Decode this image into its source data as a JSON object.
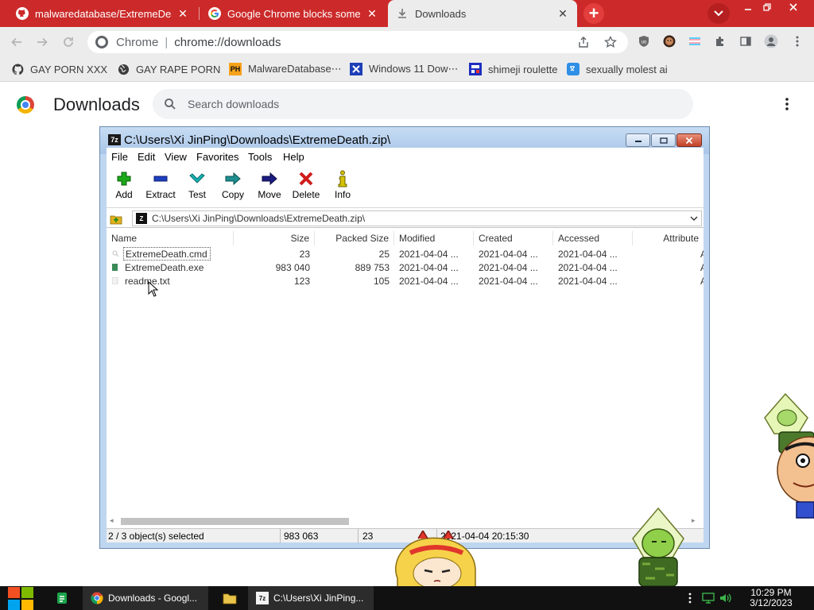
{
  "tabs": [
    {
      "title": "malwaredatabase/ExtremeDea",
      "icon": "github-icon"
    },
    {
      "title": "Google Chrome blocks some d",
      "icon": "google-icon"
    },
    {
      "title": "Downloads",
      "icon": "download-icon"
    }
  ],
  "toolbar": {
    "omnibox_host": "Chrome",
    "omnibox_url": "chrome://downloads"
  },
  "bookmarks": [
    {
      "label": "GAY PORN XXX",
      "icon": "github-icon"
    },
    {
      "label": "GAY RAPE PORN",
      "icon": "globe-icon"
    },
    {
      "label": "MalwareDatabase⋯",
      "icon": "ph-icon",
      "icon_text": "PH"
    },
    {
      "label": "Windows 11 Dow⋯",
      "icon": "x-icon"
    },
    {
      "label": "shimeji roulette",
      "icon": "mft-icon"
    },
    {
      "label": "sexually molest ai",
      "icon": "translate-icon"
    }
  ],
  "downloads": {
    "title": "Downloads",
    "search_placeholder": "Search downloads"
  },
  "zip": {
    "title": "C:\\Users\\Xi JinPing\\Downloads\\ExtremeDeath.zip\\",
    "menu": [
      "File",
      "Edit",
      "View",
      "Favorites",
      "Tools",
      "Help"
    ],
    "tools": [
      {
        "label": "Add",
        "icon": "plus-icon",
        "color": "#1aa81a"
      },
      {
        "label": "Extract",
        "icon": "minus-icon",
        "color": "#1f3fbf"
      },
      {
        "label": "Test",
        "icon": "check-icon",
        "color": "#19b3b3"
      },
      {
        "label": "Copy",
        "icon": "copy-arrow-icon",
        "color": "#1d8f8f"
      },
      {
        "label": "Move",
        "icon": "move-arrow-icon",
        "color": "#1b1b80"
      },
      {
        "label": "Delete",
        "icon": "delete-x-icon",
        "color": "#d01c1c"
      },
      {
        "label": "Info",
        "icon": "info-icon",
        "color": "#d6c200"
      }
    ],
    "path": "C:\\Users\\Xi JinPing\\Downloads\\ExtremeDeath.zip\\",
    "columns": [
      "Name",
      "Size",
      "Packed Size",
      "Modified",
      "Created",
      "Accessed",
      "Attribute"
    ],
    "files": [
      {
        "name": "ExtremeDeath.cmd",
        "size": "23",
        "packed": "25",
        "modified": "2021-04-04 ...",
        "created": "2021-04-04 ...",
        "accessed": "2021-04-04 ...",
        "attr": "A",
        "icon_color": "#bfbfbf"
      },
      {
        "name": "ExtremeDeath.exe",
        "size": "983 040",
        "packed": "889 753",
        "modified": "2021-04-04 ...",
        "created": "2021-04-04 ...",
        "accessed": "2021-04-04 ...",
        "attr": "A",
        "icon_color": "#3a8a5a"
      },
      {
        "name": "readme.txt",
        "size": "123",
        "packed": "105",
        "modified": "2021-04-04 ...",
        "created": "2021-04-04 ...",
        "accessed": "2021-04-04 ...",
        "attr": "A",
        "icon_color": "#e8e8e8"
      }
    ],
    "status": {
      "selection": "2 / 3 object(s) selected",
      "size": "983 063",
      "packed": "23",
      "datetime": "2021-04-04 20:15:30"
    }
  },
  "taskbar": {
    "chrome_label": "Downloads - Googl...",
    "zip_label": "C:\\Users\\Xi JinPing...",
    "time": "10:29 PM",
    "date": "3/12/2023"
  },
  "colors": {
    "tabstrip": "#cc2a2a",
    "chrome_chrome": "#ececec",
    "zip_frame": "#bfd6f0",
    "taskbar": "#111111"
  }
}
